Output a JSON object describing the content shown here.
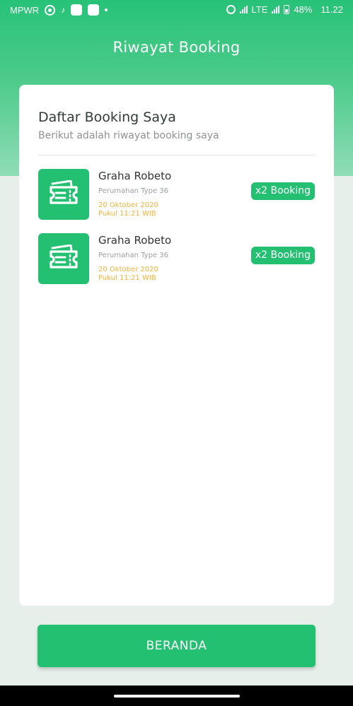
{
  "status_bar": {
    "carrier": "MPWR",
    "network": "LTE",
    "battery": "48%",
    "time": "11.22"
  },
  "header": {
    "title": "Riwayat Booking"
  },
  "card": {
    "title": "Daftar Booking Saya",
    "subtitle": "Berikut adalah riwayat booking saya"
  },
  "bookings": [
    {
      "name": "Graha Robeto",
      "type": "Perumahan Type 36",
      "date": "20 Oktober 2020",
      "time": "Pukul 11:21 WIB",
      "badge": "x2 Booking",
      "icon": "ticket-icon"
    },
    {
      "name": "Graha Robeto",
      "type": "Perumahan Type 36",
      "date": "20 Oktober 2020",
      "time": "Pukul 11:21 WIB",
      "badge": "x2 Booking",
      "icon": "ticket-icon"
    }
  ],
  "footer": {
    "button_label": "BERANDA"
  },
  "colors": {
    "primary": "#23c072",
    "accent_date": "#f2b33a",
    "background": "#e6efea"
  }
}
